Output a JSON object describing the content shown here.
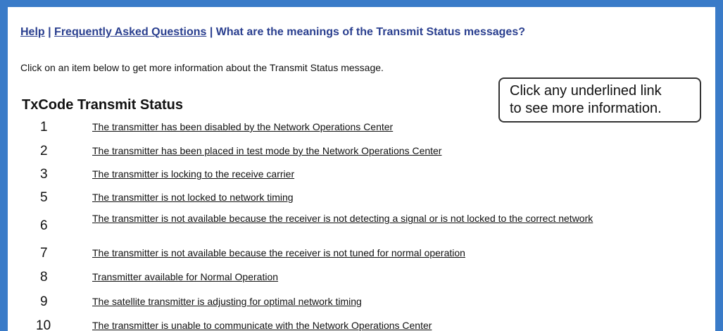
{
  "breadcrumb": {
    "help": "Help",
    "sep1": " | ",
    "faq": "Frequently Asked Questions",
    "sep2": " | ",
    "current": "What are the meanings of the Transmit Status messages?"
  },
  "intro": "Click on an item below to get more information about the Transmit Status message.",
  "table": {
    "header_code": "TxCode",
    "header_status": "Transmit Status"
  },
  "callout": {
    "line1": "Click any underlined link",
    "line2": "to see more information."
  },
  "rows": [
    {
      "code": "1",
      "status": "The transmitter has been disabled by the Network Operations Center"
    },
    {
      "code": "2",
      "status": "The transmitter has been placed in test mode by the Network Operations Center"
    },
    {
      "code": "3",
      "status": "The transmitter is locking to the receive carrier"
    },
    {
      "code": "5",
      "status": "The transmitter is not locked to network timing"
    },
    {
      "code": "6",
      "status": "The transmitter is not available because the receiver is not detecting a signal or is not locked to the correct network"
    },
    {
      "code": "7",
      "status": "The transmitter is not available because the receiver is not tuned for normal operation"
    },
    {
      "code": "8",
      "status": "Transmitter available for Normal Operation"
    },
    {
      "code": "9",
      "status": "The satellite transmitter is adjusting for optimal network timing"
    },
    {
      "code": "10",
      "status": "The transmitter is unable to communicate with the Network Operations Center"
    }
  ],
  "colors": {
    "frame": "#3a7bc8",
    "breadcrumb": "#2a3f8f"
  }
}
